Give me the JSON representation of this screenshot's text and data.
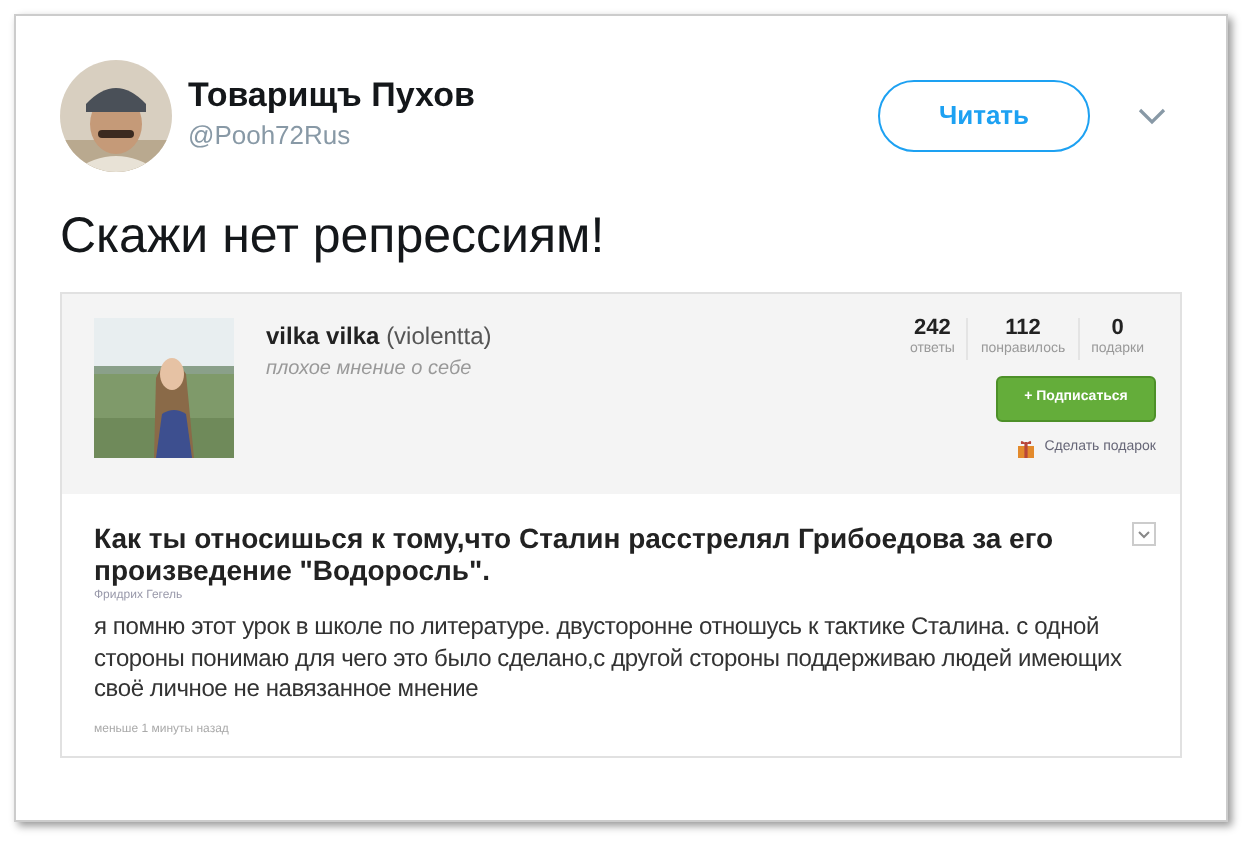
{
  "tweet": {
    "author": {
      "name": "Товарищъ Пухов",
      "handle": "@Pooh72Rus"
    },
    "follow_button": "Читать",
    "text": "Скажи нет репрессиям!"
  },
  "embedded": {
    "profile": {
      "name": "vilka vilka",
      "username": "(violentta)",
      "status": "плохое мнение о себе",
      "stats": [
        {
          "value": "242",
          "label": "ответы"
        },
        {
          "value": "112",
          "label": "понравилось"
        },
        {
          "value": "0",
          "label": "подарки"
        }
      ],
      "subscribe_button": "+ Подписаться",
      "gift_link": "Сделать подарок"
    },
    "question": {
      "text": "Как ты относишься к тому,что Сталин расстрелял Грибоедова за его произведение \"Водоросль\".",
      "asker": "Фридрих Гегель",
      "answer": "я помню этот урок в школе по литературе. двусторонне отношусь к тактике Сталина. с одной стороны понимаю для чего это было сделано,с другой стороны поддерживаю людей имеющих своё личное не навязанное мнение",
      "time": "меньше 1 минуты назад"
    }
  }
}
